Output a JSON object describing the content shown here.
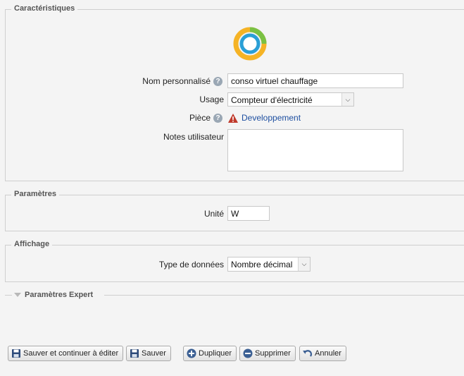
{
  "caracteristiques": {
    "legend": "Caractéristiques",
    "name_label": "Nom personnalisé",
    "name_value": "conso virtuel chauffage",
    "usage_label": "Usage",
    "usage_value": "Compteur d'électricité",
    "piece_label": "Pièce",
    "piece_link": "Developpement",
    "notes_label": "Notes utilisateur",
    "notes_value": ""
  },
  "parametres": {
    "legend": "Paramètres",
    "unit_label": "Unité",
    "unit_value": "W"
  },
  "affichage": {
    "legend": "Affichage",
    "type_label": "Type de données",
    "type_value": "Nombre décimal"
  },
  "expert": {
    "legend": "Paramètres Expert"
  },
  "buttons": {
    "save_continue": "Sauver et continuer à éditer",
    "save": "Sauver",
    "duplicate": "Dupliquer",
    "delete": "Supprimer",
    "cancel": "Annuler"
  },
  "icons": {
    "device": "ring-gauge-icon",
    "help": "help-icon",
    "warning": "warning-icon",
    "save": "floppy-icon",
    "duplicate": "plus-circle-icon",
    "delete": "minus-circle-icon",
    "cancel": "undo-icon"
  },
  "colors": {
    "ring_outer": "#f5b325",
    "ring_green": "#7ac143",
    "ring_inner": "#2a9fd6",
    "warning": "#c0392b",
    "link": "#1e4fa0"
  }
}
